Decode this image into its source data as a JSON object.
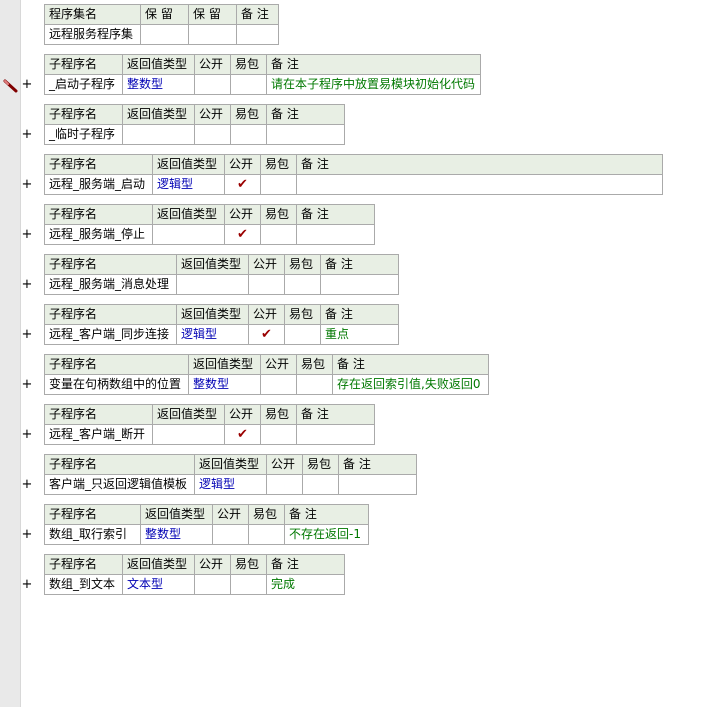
{
  "assembly": {
    "headers": [
      "程序集名",
      "保 留",
      "保 留",
      "备 注"
    ],
    "name": "远程服务程序集"
  },
  "sub_headers": {
    "name": "子程序名",
    "return_type": "返回值类型",
    "public": "公开",
    "easy_pack": "易包",
    "note": "备 注"
  },
  "check_mark": "✔",
  "plus_symbol": "+",
  "subroutines": [
    {
      "name": "_启动子程序",
      "return_type": "整数型",
      "public": "",
      "note": "请在本子程序中放置易模块初始化代码"
    },
    {
      "name": "_临时子程序",
      "return_type": "",
      "public": "",
      "note": ""
    },
    {
      "name": "远程_服务端_启动",
      "return_type": "逻辑型",
      "public": "✔",
      "note": ""
    },
    {
      "name": "远程_服务端_停止",
      "return_type": "",
      "public": "✔",
      "note": ""
    },
    {
      "name": "远程_服务端_消息处理",
      "return_type": "",
      "public": "",
      "note": ""
    },
    {
      "name": "远程_客户端_同步连接",
      "return_type": "逻辑型",
      "public": "✔",
      "note": "重点"
    },
    {
      "name": "变量在句柄数组中的位置",
      "return_type": "整数型",
      "public": "",
      "note": "存在返回索引值,失败返回0"
    },
    {
      "name": "远程_客户端_断开",
      "return_type": "",
      "public": "✔",
      "note": ""
    },
    {
      "name": "客户端_只返回逻辑值模板",
      "return_type": "逻辑型",
      "public": "",
      "note": ""
    },
    {
      "name": "数组_取行索引",
      "return_type": "整数型",
      "public": "",
      "note": "不存在返回-1"
    },
    {
      "name": "数组_到文本",
      "return_type": "文本型",
      "public": "",
      "note": "完成"
    }
  ]
}
